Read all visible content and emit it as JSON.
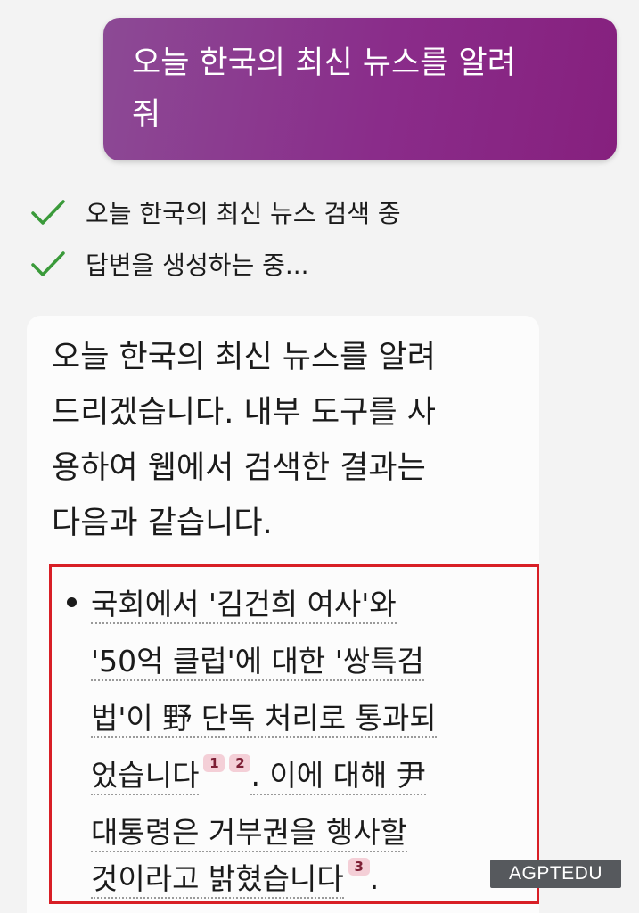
{
  "user_message": {
    "line1": "오늘 한국의 최신 뉴스를 알려",
    "line2": "줘",
    "gradient_start": "#8c4a95",
    "gradient_end": "#86207e"
  },
  "status_steps": [
    {
      "icon": "check-icon",
      "label": "오늘 한국의 최신 뉴스 검색 중",
      "color": "#3a9a3a"
    },
    {
      "icon": "check-icon",
      "label": "답변을 생성하는 중...",
      "color": "#3a9a3a"
    }
  ],
  "answer": {
    "intro_lines": [
      "오늘 한국의 최신 뉴스를 알려",
      "드리겠습니다. 내부 도구를 사",
      "용하여 웹에서 검색한 결과는",
      "다음과 같습니다."
    ],
    "bullet": {
      "line1": "국회에서 '김건희 여사'와",
      "line2": "'50억 클럽'에 대한 '쌍특검",
      "line3": "법'이 野 단독 처리로 통과되",
      "line4_text": "었습니다",
      "line4_cites": [
        "1",
        "2"
      ],
      "line4_tail": ". 이에 대해 尹",
      "line5": "대통령은 거부권을 행사할",
      "line6_text": "것이라고 밝혔습니다",
      "line6_cites": [
        "3"
      ],
      "line6_tail": "."
    },
    "highlight_color": "#d81f26"
  },
  "watermark": "AGPTEDU"
}
